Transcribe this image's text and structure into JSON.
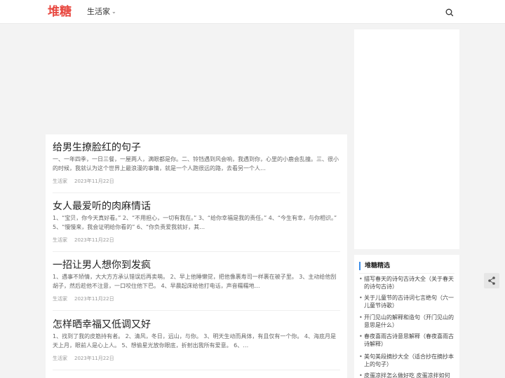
{
  "site": {
    "logo_text": "堆糖",
    "logo_color": "#e8473f"
  },
  "nav": {
    "items": [
      {
        "label": "生活家"
      }
    ]
  },
  "icons": {
    "search": "search-icon",
    "chevron": "chevron-down-icon",
    "share": "share-icon"
  },
  "articles": [
    {
      "title": "给男生撩脸红的句子",
      "excerpt": "一、一年四季，一日三餐，一屋两人，满眼都是你。二、铃铛遇到风会响，我遇到你，心里的小鹿会乱撞。三、很小的时候，我就认为这个世界上最浪漫的事情，就是一个人跑很远的路，去看另一个人…",
      "category": "生活家",
      "date": "2023年11月22日"
    },
    {
      "title": "女人最爱听的肉麻情话",
      "excerpt": "1、“宝贝，你今天真好看。” 2、“不用担心，一切有我在。” 3、“给你幸福是我的责任。” 4、“今生有幸，与你相识。” 5、“慢慢来，我会证明给你看的” 6、“你负责爱我就好，其…",
      "category": "生活家",
      "date": "2023年11月22日"
    },
    {
      "title": "一招让男人想你到发疯",
      "excerpt": "1、遇事不矫情，大大方方承认错误后再卖萌。 2、早上他睡懒觉，把他像裹寿司一样裹在被子里。 3、主动给他刮胡子，然后趁他不注意，一口咬住他下巴。 4、早晨起床给他打电话，声音糯糯地…",
      "category": "生活家",
      "date": "2023年11月22日"
    },
    {
      "title": "怎样晒幸福又低调又好",
      "excerpt": "1、找到了我的皮筋持有者。 2、清风，冬日，远山，与你。 3、明天生动而具体，有且仅有一个你。 4、海底月是天上月，眼前人是心上人。 5、想偷星光放你眼底，折射出我所有爱意。 6、…",
      "category": "生活家",
      "date": "2023年11月22日"
    }
  ],
  "sidebar": {
    "widget_title": "堆糖精选",
    "accent_color": "#3d8ee8",
    "picks": [
      "描写春天的诗句古诗大全（关于春天的诗句古诗）",
      "关于儿童节的古诗词七言绝句（六一儿童节诗歌）",
      "开门见山的解释和造句（开门见山的意思是什么）",
      "春夜喜雨古诗意思解释（春夜喜雨古诗解释）",
      "美句美段摘抄大全（适合抄在摘抄本上的句子）",
      "皮蛋凉拌怎么做好吃 皮蛋凉拌如何做好吃"
    ]
  }
}
